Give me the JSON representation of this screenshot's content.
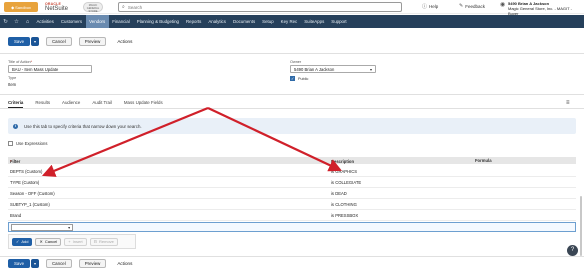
{
  "topbar": {
    "sandbox_label": "Sandbox",
    "oracle_label": "ORACLE",
    "netsuite_label": "NetSuite",
    "company_logo_text": "MAGIC GENERAL STORE",
    "search_placeholder": "Search",
    "help_label": "Help",
    "feedback_label": "Feedback",
    "user_name": "5490 Brian A Jackson",
    "user_role": "Magic General Store, Inc. - MAGIT - Buyer",
    "icons": [
      "refresh-icon",
      "star-icon",
      "home-icon",
      "search-icon",
      "help-icon",
      "feedback-icon",
      "user-icon"
    ]
  },
  "nav": {
    "items": [
      "Activities",
      "Customers",
      "Vendors",
      "Financial",
      "Planning & Budgeting",
      "Reports",
      "Analytics",
      "Documents",
      "Setup",
      "Key Rec",
      "SuiteApps",
      "Support"
    ],
    "active_index": 2
  },
  "toolbar": {
    "save_label": "Save",
    "cancel_label": "Cancel",
    "preview_label": "Preview",
    "actions_label": "Actions"
  },
  "form": {
    "title_label": "Title of Action",
    "title_value": "BAU - Item Mass Update",
    "type_label": "Type",
    "type_value": "Item",
    "owner_label": "Owner",
    "owner_value": "5490 Brian A Jackson",
    "public_label": "Public",
    "public_checked": true
  },
  "tabs": {
    "items": [
      "Criteria",
      "Results",
      "Audience",
      "Audit Trail",
      "Mass Update Fields"
    ],
    "active_index": 0
  },
  "info": {
    "message": "Use this tab to specify criteria that narrow down your search."
  },
  "use_expressions_label": "Use Expressions",
  "grid": {
    "headers": {
      "filter": "Filter",
      "description": "Description",
      "formula": "Formula"
    },
    "rows": [
      {
        "filter": "DEPTS (Custom)",
        "description": "is GRAPHICS",
        "formula": ""
      },
      {
        "filter": "TYPE (Custom)",
        "description": "is COLLEGIATE",
        "formula": ""
      },
      {
        "filter": "Season - OFF (Custom)",
        "description": "is DEAD",
        "formula": ""
      },
      {
        "filter": "SUBTYP_1 (Custom)",
        "description": "is CLOTHING",
        "formula": ""
      },
      {
        "filter": "Brand",
        "description": "is PRESSBOX",
        "formula": ""
      }
    ]
  },
  "row_actions": {
    "add_label": "Add",
    "cancel_label": "Cancel",
    "insert_label": "Insert",
    "remove_label": "Remove"
  },
  "colors": {
    "nav_bg": "#26405b",
    "nav_active": "#6a8bb0",
    "primary": "#1f5fa6",
    "annotation_arrow": "#d0202a",
    "sandbox": "#e8a33c"
  }
}
